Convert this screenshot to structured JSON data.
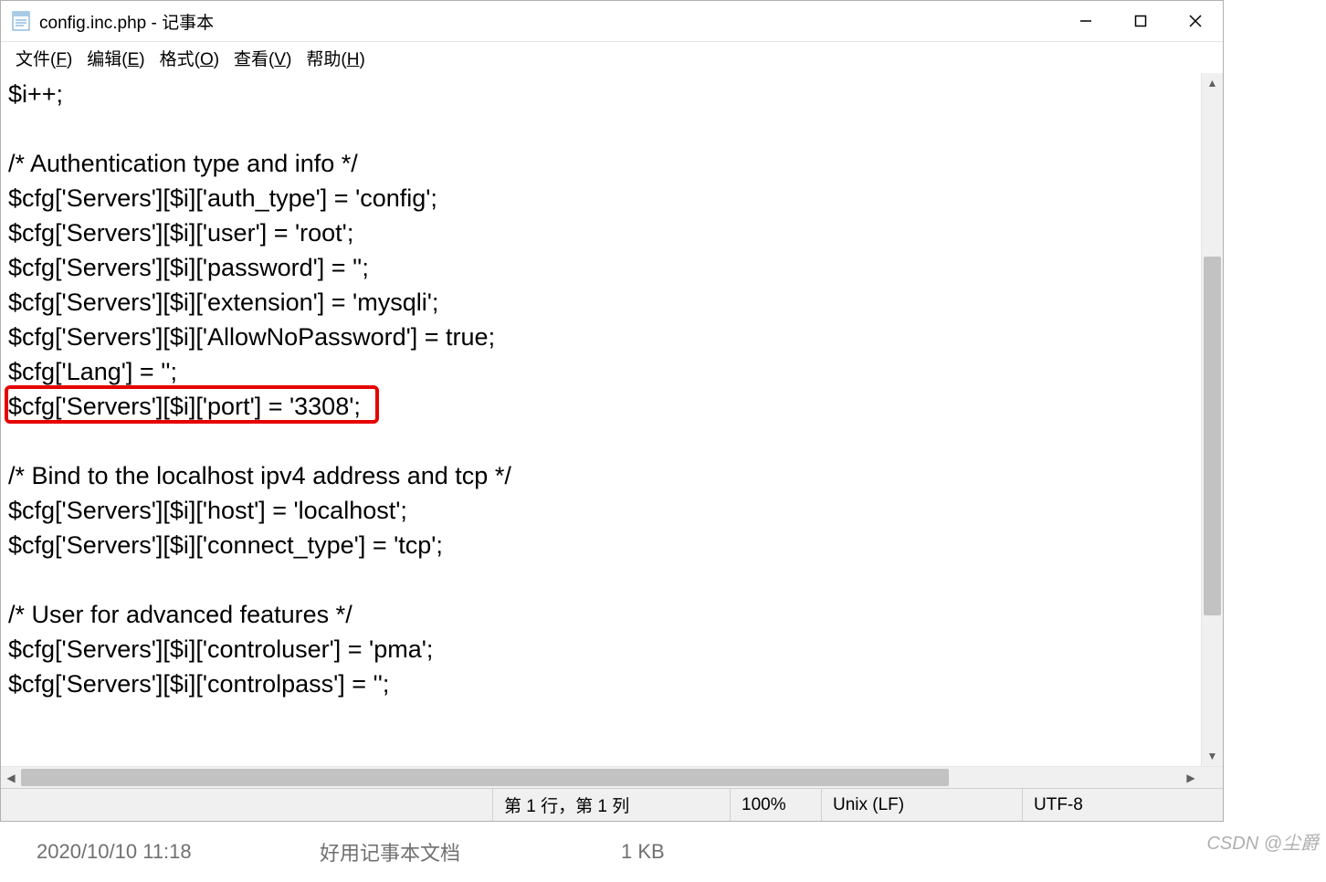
{
  "titlebar": {
    "title": "config.inc.php - 记事本",
    "icon": "notepad-icon"
  },
  "menu": {
    "file": "文件(F)",
    "edit": "编辑(E)",
    "format": "格式(O)",
    "view": "查看(V)",
    "help": "帮助(H)"
  },
  "editor": {
    "lines": [
      "$i++;",
      "",
      "/* Authentication type and info */",
      "$cfg['Servers'][$i]['auth_type'] = 'config';",
      "$cfg['Servers'][$i]['user'] = 'root';",
      "$cfg['Servers'][$i]['password'] = '';",
      "$cfg['Servers'][$i]['extension'] = 'mysqli';",
      "$cfg['Servers'][$i]['AllowNoPassword'] = true;",
      "$cfg['Lang'] = '';",
      "$cfg['Servers'][$i]['port'] = '3308';",
      "",
      "/* Bind to the localhost ipv4 address and tcp */",
      "$cfg['Servers'][$i]['host'] = 'localhost';",
      "$cfg['Servers'][$i]['connect_type'] = 'tcp';",
      "",
      "/* User for advanced features */",
      "$cfg['Servers'][$i]['controluser'] = 'pma';",
      "$cfg['Servers'][$i]['controlpass'] = '';"
    ],
    "highlighted_line_index": 9
  },
  "statusbar": {
    "position": "第 1 行，第 1 列",
    "zoom": "100%",
    "line_ending": "Unix (LF)",
    "encoding": "UTF-8"
  },
  "background_crop": {
    "datetime": "2020/10/10 11:18",
    "filetype_partial": "好用记事本文档",
    "size_partial": "1 KB"
  },
  "watermark": "CSDN @尘爵"
}
